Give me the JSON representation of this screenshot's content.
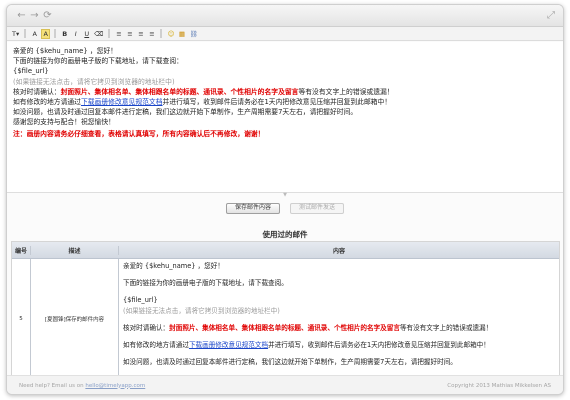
{
  "toolbar": {
    "format_label": "T",
    "font_color_label": "A",
    "bg_color_label": "A",
    "bold_label": "B",
    "italic_label": "I",
    "underline_label": "U",
    "clear_label": "⌫",
    "align_left": "≡",
    "align_center": "≡",
    "align_right": "≡",
    "align_justify": "≡",
    "emoji_label": "☺",
    "image_label": "▦",
    "link_label": "⛓"
  },
  "editor": {
    "greeting": "亲爱的 {$kehu_name} ，您好！",
    "intro": "下面的链接为你的画册电子版的下载地址，请下载查阅：",
    "file_url": "{$file_url}",
    "hint": "(如果链接无法点击，请将它拷贝到浏览器的地址栏中)",
    "confirm_prefix": "核对时请确认：",
    "confirm_red": "封面照片、集体相名单、集体相跟名单的标题、通讯录、个性相片的名字及留言",
    "confirm_suffix": "等有没有文字上的错误或遗漏！",
    "modify_prefix": "如有修改的地方请通过",
    "modify_link": "下载画册修改意见规范文档",
    "modify_suffix": "并进行填写，收到邮件后请务必在1天内把修改意见压缩并回复到此邮箱中！",
    "no_issue": "如没问题，也请及时通过回复本邮件进行定稿，我们这边就开始下单制作，生产周期需要7天左右，请把握好时间。",
    "thanks": "感谢您的支持与配合！祝您愉快！",
    "note": "注：画册内容请务必仔细查看，表格请认真填写，所有内容确认后不再修改，谢谢！"
  },
  "buttons": {
    "save": "保存邮件内容",
    "test": "测试邮件发送"
  },
  "used_section": {
    "title": "使用过的邮件",
    "headers": [
      "编号",
      "描述",
      "内容"
    ],
    "row": {
      "id": "5",
      "desc": "[夏圆锋]保存的邮件内容",
      "greeting": "亲爱的 {$kehu_name} ，您好！",
      "intro": "下面的链接为你的画册电子版的下载地址，请下载查阅。",
      "file_url": "{$file_url}",
      "hint": "(如果链接无法点击，请将它拷贝到浏览器的地址栏中)",
      "confirm_prefix": "核对时请确认：",
      "confirm_red": "封面照片、集体相名单、集体相跟名单的标题、通讯录、个性相片的名字及留言",
      "confirm_suffix": "等有没有文字上的错误或遗漏！",
      "modify_prefix": "如有修改的地方请通过",
      "modify_link": "下载画册修改意见规范文档",
      "modify_suffix": "并进行填写，收到邮件后请务必在1天内把修改意见压缩并回复到此邮箱中！",
      "no_issue": "如没问题，也请及时通过回复本邮件进行定稿，我们这边就开始下单制作，生产周期需要7天左右，请把握好时间。"
    }
  },
  "footer": {
    "help_prefix": "Need help? Email us on",
    "help_email": "hello@timelyapp.com",
    "copyright": "Copyright 2013 Mathias Mikkelsen AS"
  },
  "colors": {
    "red": "#e00000",
    "link": "#1a45c9"
  }
}
